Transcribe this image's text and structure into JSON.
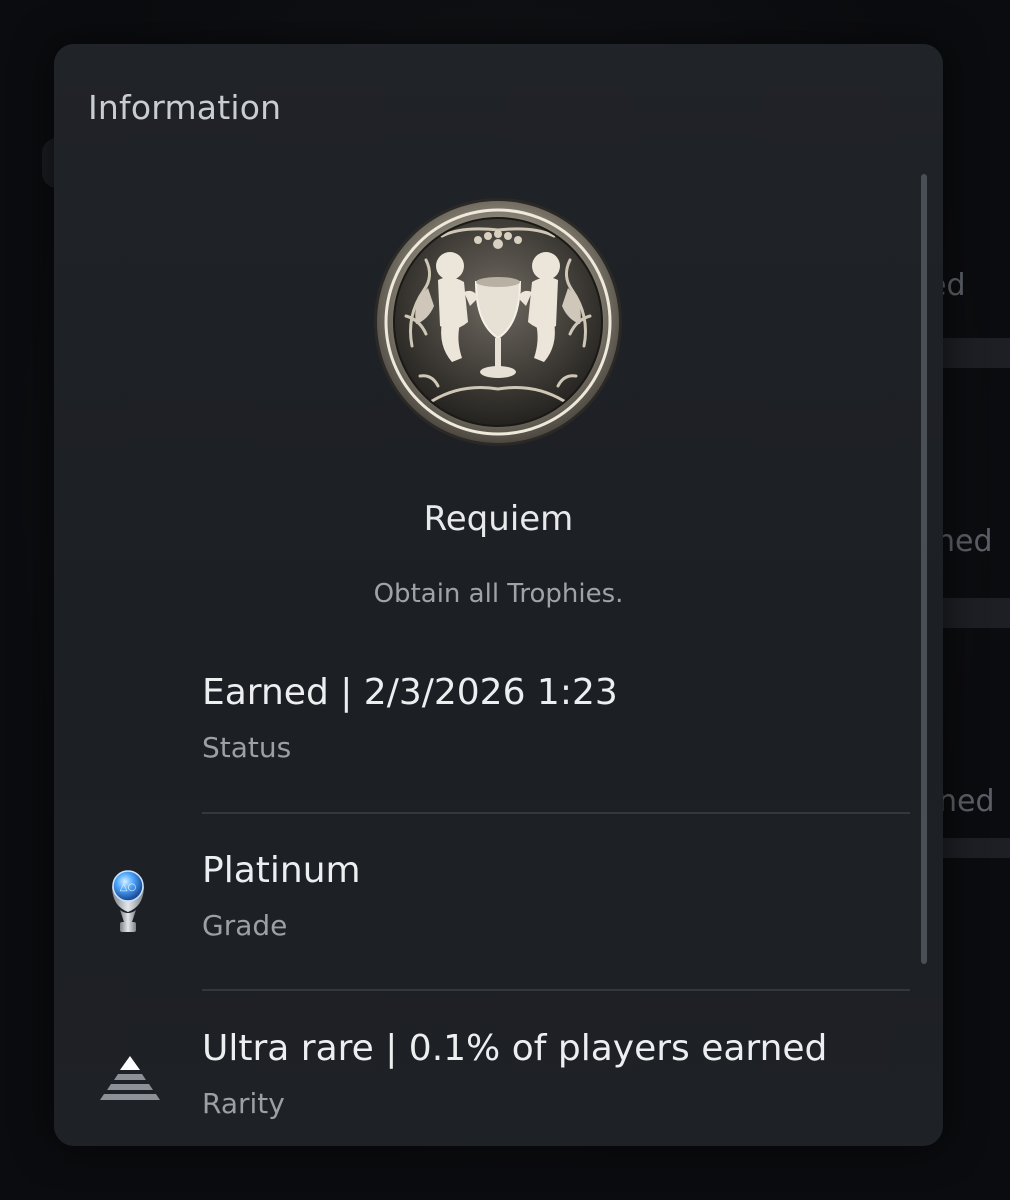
{
  "panel": {
    "title": "Information"
  },
  "trophy": {
    "name": "Requiem",
    "description": "Obtain all Trophies."
  },
  "details": [
    {
      "value": "Earned | 2/3/2026  1:23",
      "label": "Status",
      "icon": ""
    },
    {
      "value": "Platinum",
      "label": "Grade",
      "icon": "platinum-trophy-icon"
    },
    {
      "value": "Ultra rare | 0.1% of players earned",
      "label": "Rarity",
      "icon": "rarity-pyramid-icon"
    }
  ],
  "background": {
    "fragments": [
      "ed",
      "ned",
      "ned"
    ]
  },
  "colors": {
    "panel": "#1e2126",
    "text_primary": "#eceef0",
    "text_secondary": "#9b9fa6",
    "platinum_blue": "#4fa8ff"
  }
}
